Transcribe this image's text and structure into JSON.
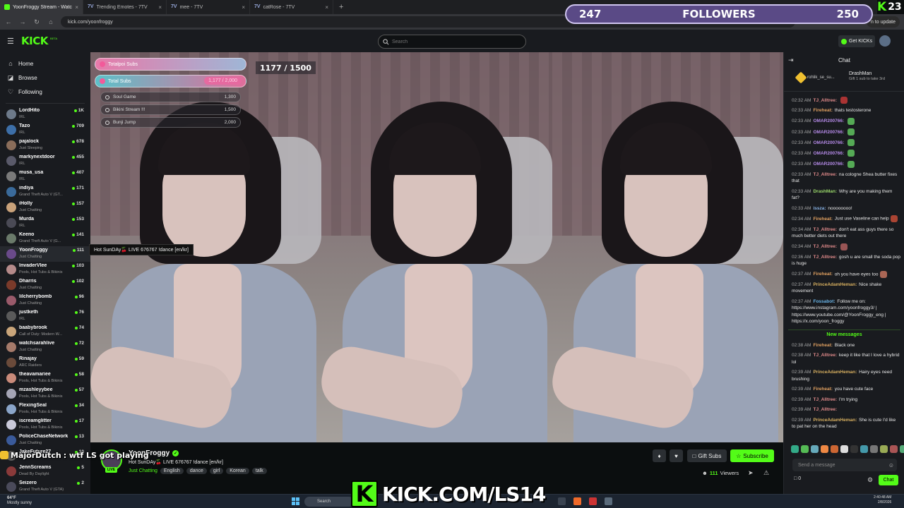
{
  "browser": {
    "tabs": [
      {
        "label": "YoonFroggy Stream - Watc",
        "active": true
      },
      {
        "label": "Trending Emotes - 7TV",
        "active": false
      },
      {
        "label": "mee - 7TV",
        "active": false
      },
      {
        "label": "catRose - 7TV",
        "active": false
      }
    ],
    "new_tab": "+",
    "url": "kick.com/yoonfroggy",
    "update_label": "n to update"
  },
  "header": {
    "logo": "KICK",
    "logo_badge": "BETA",
    "search_placeholder": "Search",
    "get_kicks_label": "Get KICKs"
  },
  "overlay": {
    "followers_current": "247",
    "followers_label": "FOLLOWERS",
    "followers_goal": "250",
    "kick_badge": "23",
    "chat_user": "MajorDutch",
    "chat_text": ": wtf LS got playing",
    "kick_url": "KICK.COM/LS14",
    "kick_k": "K",
    "sub_counter": "1177 / 1500",
    "sub_bars": [
      {
        "label": "Totalpoi Subs",
        "value": ""
      },
      {
        "label": "Total Subs",
        "value": "1,177 / 2,000"
      }
    ],
    "goals": [
      {
        "label": "Soul Game",
        "value": "1,300"
      },
      {
        "label": "Bikini Stream !!!",
        "value": "1,500"
      },
      {
        "label": "Bunji Jump",
        "value": "2,000"
      }
    ]
  },
  "sidebar": {
    "nav": [
      {
        "label": "Home",
        "icon": "home-icon"
      },
      {
        "label": "Browse",
        "icon": "browse-icon"
      },
      {
        "label": "Following",
        "icon": "heart-icon"
      }
    ],
    "channels": [
      {
        "name": "LordHito",
        "category": "IRL",
        "viewers": "1K",
        "color": "#6d7a8a"
      },
      {
        "name": "Tazo",
        "category": "IRL",
        "viewers": "709",
        "color": "#3d6fa8"
      },
      {
        "name": "pajalock",
        "category": "Just Sleeping",
        "viewers": "678",
        "color": "#8a6d5a"
      },
      {
        "name": "markynextdoor",
        "category": "IRL",
        "viewers": "455",
        "color": "#5a5a6a"
      },
      {
        "name": "musa_usa",
        "category": "IRL",
        "viewers": "407",
        "color": "#7a7a7a"
      },
      {
        "name": "indiya",
        "category": "Grand Theft Auto V (GT...",
        "viewers": "171",
        "color": "#3a6a9a"
      },
      {
        "name": "iHolly",
        "category": "Just Chatting",
        "viewers": "157",
        "color": "#c9a27a"
      },
      {
        "name": "Murda",
        "category": "IRL",
        "viewers": "153",
        "color": "#4a4a55"
      },
      {
        "name": "Keeno",
        "category": "Grand Theft Auto V (G...",
        "viewers": "141",
        "color": "#6a7a6a"
      },
      {
        "name": "YoonFroggy",
        "category": "Just Chatting",
        "viewers": "111",
        "color": "#6a4a8a"
      },
      {
        "name": "InvaderVlee",
        "category": "Pools, Hot Tubs & Bikinis",
        "viewers": "103",
        "color": "#b58a8a"
      },
      {
        "name": "Dharris",
        "category": "Just Chatting",
        "viewers": "102",
        "color": "#7a3a2a"
      },
      {
        "name": "lilcherrybomb",
        "category": "Just Chatting",
        "viewers": "96",
        "color": "#9a5a6a"
      },
      {
        "name": "justketh",
        "category": "IRL",
        "viewers": "76",
        "color": "#5a5a5a"
      },
      {
        "name": "baabybrook",
        "category": "Call of Duty: Modern W...",
        "viewers": "74",
        "color": "#c9a57a"
      },
      {
        "name": "watchsarahlive",
        "category": "Just Chatting",
        "viewers": "72",
        "color": "#a57a6a"
      },
      {
        "name": "Rinajay",
        "category": "ARC Raiders",
        "viewers": "59",
        "color": "#6a4a3a"
      },
      {
        "name": "theavamariee",
        "category": "Pools, Hot Tubs & Bikinis",
        "viewers": "58",
        "color": "#c98a7a"
      },
      {
        "name": "mzashleyybee",
        "category": "Pools, Hot Tubs & Bikinis",
        "viewers": "57",
        "color": "#a5a5b5"
      },
      {
        "name": "FlexingSeal",
        "category": "Pools, Hot Tubs & Bikinis",
        "viewers": "34",
        "color": "#8aa5c9"
      },
      {
        "name": "iscreamglitter",
        "category": "Pools, Hot Tubs & Bikinis",
        "viewers": "17",
        "color": "#c9c9d9"
      },
      {
        "name": "PoliceChaseNetwork",
        "category": "Just Chatting",
        "viewers": "13",
        "color": "#3a5a9a"
      },
      {
        "name": "JakeFuture27",
        "category": "",
        "viewers": "10",
        "color": "#5a5a5a"
      },
      {
        "name": "JennScreams",
        "category": "Dead By Daylight",
        "viewers": "5",
        "color": "#8a3a3a"
      },
      {
        "name": "Seizero",
        "category": "Grand Theft Auto V (GTA)",
        "viewers": "2",
        "color": "#4a4a5a"
      }
    ],
    "tooltip": "Hot SunDAy🍒 LIVE 676767 !dance [en/kr]"
  },
  "stream": {
    "name": "YoonFroggy",
    "title": "Hot SunDAy🍒 LIVE 676767 !dance [en/kr]",
    "category": "Just Chatting",
    "tags": [
      "English",
      "dance",
      "girl",
      "Korean",
      "talk"
    ],
    "live_badge": "LIVE",
    "viewers_count": "111",
    "viewers_label": "Viewers",
    "gift_subs_label": "Gift Subs",
    "subscribe_label": "Subscribe"
  },
  "chat": {
    "title": "Chat",
    "pinned_left": "rohlik_se_su...",
    "pinned_user": "DrashMan",
    "pinned_text": "Gift 1 sub to take 3rd",
    "messages": [
      {
        "time": "02:32 AM",
        "user": "TJ_Alltree:",
        "color": "#e08a8a",
        "text": "",
        "emote": "#a33"
      },
      {
        "time": "02:33 AM",
        "user": "Fireheat:",
        "color": "#e0a060",
        "text": "thats testosterone",
        "emote": ""
      },
      {
        "time": "02:33 AM",
        "user": "OMAR200766:",
        "color": "#b58ae8",
        "text": "",
        "emote": "#5a5"
      },
      {
        "time": "02:33 AM",
        "user": "OMAR200766:",
        "color": "#b58ae8",
        "text": "",
        "emote": "#5a5"
      },
      {
        "time": "02:33 AM",
        "user": "OMAR200766:",
        "color": "#b58ae8",
        "text": "",
        "emote": "#5a5"
      },
      {
        "time": "02:33 AM",
        "user": "OMAR200766:",
        "color": "#b58ae8",
        "text": "",
        "emote": "#5a5"
      },
      {
        "time": "02:33 AM",
        "user": "OMAR200766:",
        "color": "#b58ae8",
        "text": "",
        "emote": "#5a5"
      },
      {
        "time": "02:33 AM",
        "user": "TJ_Alltree:",
        "color": "#e08a8a",
        "text": "na cologne Shea butter fixes that",
        "emote": ""
      },
      {
        "time": "02:33 AM",
        "user": "DrashMan:",
        "color": "#9ad86a",
        "text": "Why are you making them fat?",
        "emote": ""
      },
      {
        "time": "02:33 AM",
        "user": "issza:",
        "color": "#8ab5e8",
        "text": "noooooooo!",
        "emote": ""
      },
      {
        "time": "02:34 AM",
        "user": "Fireheat:",
        "color": "#e0a060",
        "text": "Just use Vaseline can help",
        "emote": "#a43"
      },
      {
        "time": "02:34 AM",
        "user": "TJ_Alltree:",
        "color": "#e08a8a",
        "text": "don't eat ass guys there so much better diets out there",
        "emote": ""
      },
      {
        "time": "02:34 AM",
        "user": "TJ_Alltree:",
        "color": "#e08a8a",
        "text": "",
        "emote": "#955"
      },
      {
        "time": "02:36 AM",
        "user": "TJ_Alltree:",
        "color": "#e08a8a",
        "text": "gosh u are small the soda pop is huge",
        "emote": ""
      },
      {
        "time": "02:37 AM",
        "user": "Fireheat:",
        "color": "#e0a060",
        "text": "oh you have eyes too",
        "emote": "#a65"
      },
      {
        "time": "02:37 AM",
        "user": "PrinceAdamHeman:",
        "color": "#d8b060",
        "text": "Nice shake movement",
        "emote": ""
      },
      {
        "time": "02:37 AM",
        "user": "Fossabot:",
        "color": "#6ab5e8",
        "text": "Follow me on: https://www.instagram.com/yoonfroggy3/ | https://www.youtube.com/@YoonFroggy_eng | https://x.com/yoon_froggy",
        "emote": ""
      }
    ],
    "new_messages_label": "New messages",
    "messages_after": [
      {
        "time": "02:38 AM",
        "user": "Fireheat:",
        "color": "#e0a060",
        "text": "Black one"
      },
      {
        "time": "02:38 AM",
        "user": "TJ_Alltree:",
        "color": "#e08a8a",
        "text": "keep it like that I love a hybrid lol"
      },
      {
        "time": "02:39 AM",
        "user": "PrinceAdamHeman:",
        "color": "#d8b060",
        "text": "Hairy eyes need brushing"
      },
      {
        "time": "02:39 AM",
        "user": "Fireheat:",
        "color": "#e0a060",
        "text": "you have cute face"
      },
      {
        "time": "02:39 AM",
        "user": "TJ_Alltree:",
        "color": "#e08a8a",
        "text": "I'm trying"
      },
      {
        "time": "02:39 AM",
        "user": "TJ_Alltree:",
        "color": "#e08a8a",
        "text": ""
      },
      {
        "time": "02:39 AM",
        "user": "PrinceAdamHeman:",
        "color": "#d8b060",
        "text": "She is cute I'd like to pat her on the head"
      }
    ],
    "input_placeholder": "Send a message",
    "gift_count": "0",
    "send_label": "Chat"
  },
  "taskbar": {
    "temp": "64°F",
    "weather": "Mostly sunny",
    "search": "Search",
    "time": "2:40:48 AM",
    "date": "2/8/2026"
  },
  "colors": {
    "accent": "#53fc18",
    "followers_bar": "#5a4a86"
  }
}
